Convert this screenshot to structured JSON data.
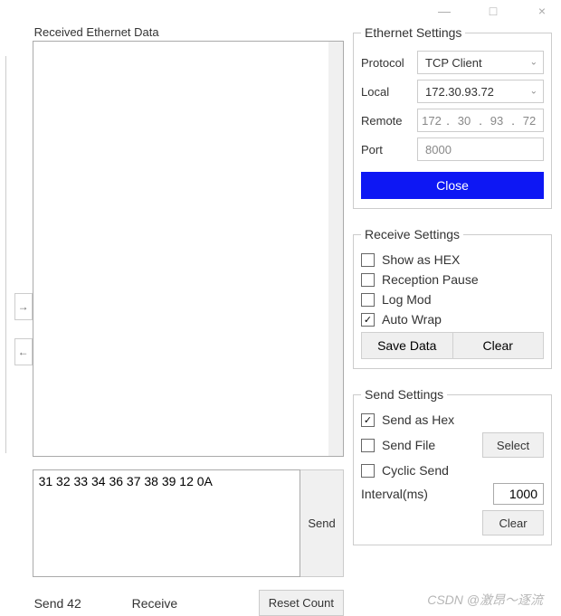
{
  "window_controls": {
    "min": "—",
    "max": "□",
    "close": "×"
  },
  "received": {
    "label": "Received Ethernet Data",
    "content": ""
  },
  "arrow_right": "→",
  "arrow_left": "←",
  "send_box": {
    "value": "31 32 33 34 36 37 38 39 12 0A",
    "button": "Send"
  },
  "status": {
    "send": "Send 42",
    "receive": "Receive",
    "reset": "Reset Count"
  },
  "ethernet": {
    "legend": "Ethernet Settings",
    "protocol_label": "Protocol",
    "protocol_value": "TCP Client",
    "local_label": "Local",
    "local_value": "172.30.93.72",
    "remote_label": "Remote",
    "remote_ip": [
      "172",
      "30",
      "93",
      "72"
    ],
    "port_label": "Port",
    "port_value": "8000",
    "close_button": "Close"
  },
  "receive_settings": {
    "legend": "Receive Settings",
    "show_hex": {
      "label": "Show as HEX",
      "checked": false
    },
    "reception_pause": {
      "label": "Reception Pause",
      "checked": false
    },
    "log_mod": {
      "label": "Log Mod",
      "checked": false
    },
    "auto_wrap": {
      "label": "Auto Wrap",
      "checked": true
    },
    "save_data": "Save Data",
    "clear": "Clear"
  },
  "send_settings": {
    "legend": "Send Settings",
    "send_hex": {
      "label": "Send as Hex",
      "checked": true
    },
    "send_file": {
      "label": "Send File",
      "checked": false
    },
    "select": "Select",
    "cyclic_send": {
      "label": "Cyclic Send",
      "checked": false
    },
    "interval_label": "Interval(ms)",
    "interval_value": "1000",
    "clear": "Clear"
  },
  "check_mark": "✓",
  "watermark": "CSDN @激昂～逐流"
}
